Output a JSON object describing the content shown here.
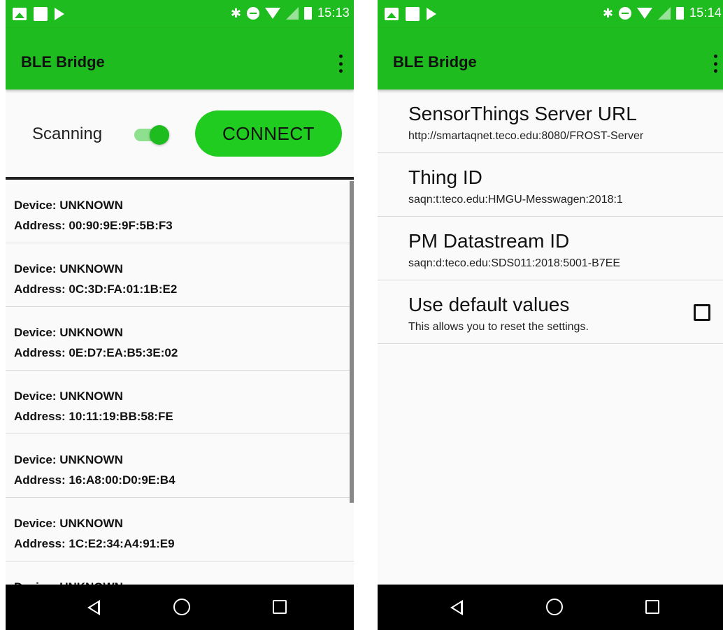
{
  "screens": {
    "left": {
      "status_bar": {
        "time": "15:13",
        "bluetooth_glyph": "✱"
      },
      "app_bar": {
        "title": "BLE Bridge"
      },
      "controls": {
        "scan_label": "Scanning",
        "scan_enabled": true,
        "connect_label": "CONNECT"
      },
      "devices": [
        {
          "name": "Device: UNKNOWN",
          "address": "Address: 00:90:9E:9F:5B:F3"
        },
        {
          "name": "Device: UNKNOWN",
          "address": "Address: 0C:3D:FA:01:1B:E2"
        },
        {
          "name": "Device: UNKNOWN",
          "address": "Address: 0E:D7:EA:B5:3E:02"
        },
        {
          "name": "Device: UNKNOWN",
          "address": "Address: 10:11:19:BB:58:FE"
        },
        {
          "name": "Device: UNKNOWN",
          "address": "Address: 16:A8:00:D0:9E:B4"
        },
        {
          "name": "Device: UNKNOWN",
          "address": "Address: 1C:E2:34:A4:91:E9"
        },
        {
          "name": "Device: UNKNOWN",
          "address": ""
        }
      ]
    },
    "right": {
      "status_bar": {
        "time": "15:14",
        "bluetooth_glyph": "✱"
      },
      "app_bar": {
        "title": "BLE Bridge"
      },
      "settings": [
        {
          "title": "SensorThings Server URL",
          "summary": "http://smartaqnet.teco.edu:8080/FROST-Server"
        },
        {
          "title": "Thing ID",
          "summary": "saqn:t:teco.edu:HMGU-Messwagen:2018:1"
        },
        {
          "title": "PM Datastream ID",
          "summary": "saqn:d:teco.edu:SDS011:2018:5001-B7EE"
        },
        {
          "title": "Use default values",
          "summary": "This allows you to reset the settings.",
          "checked": false
        }
      ]
    }
  },
  "icons": {
    "status": [
      "image-icon",
      "square-notification-icon",
      "play-store-icon",
      "bluetooth-icon",
      "do-not-disturb-icon",
      "wifi-icon",
      "signal-icon",
      "battery-icon"
    ],
    "navigation": [
      "back-icon",
      "home-icon",
      "recent-apps-icon"
    ],
    "app_bar": "overflow-menu-icon"
  },
  "colors": {
    "primary": "#1fbc1f",
    "connect_button": "#1fcc1f",
    "background": "#fafafa",
    "nav_bar": "#000000"
  }
}
